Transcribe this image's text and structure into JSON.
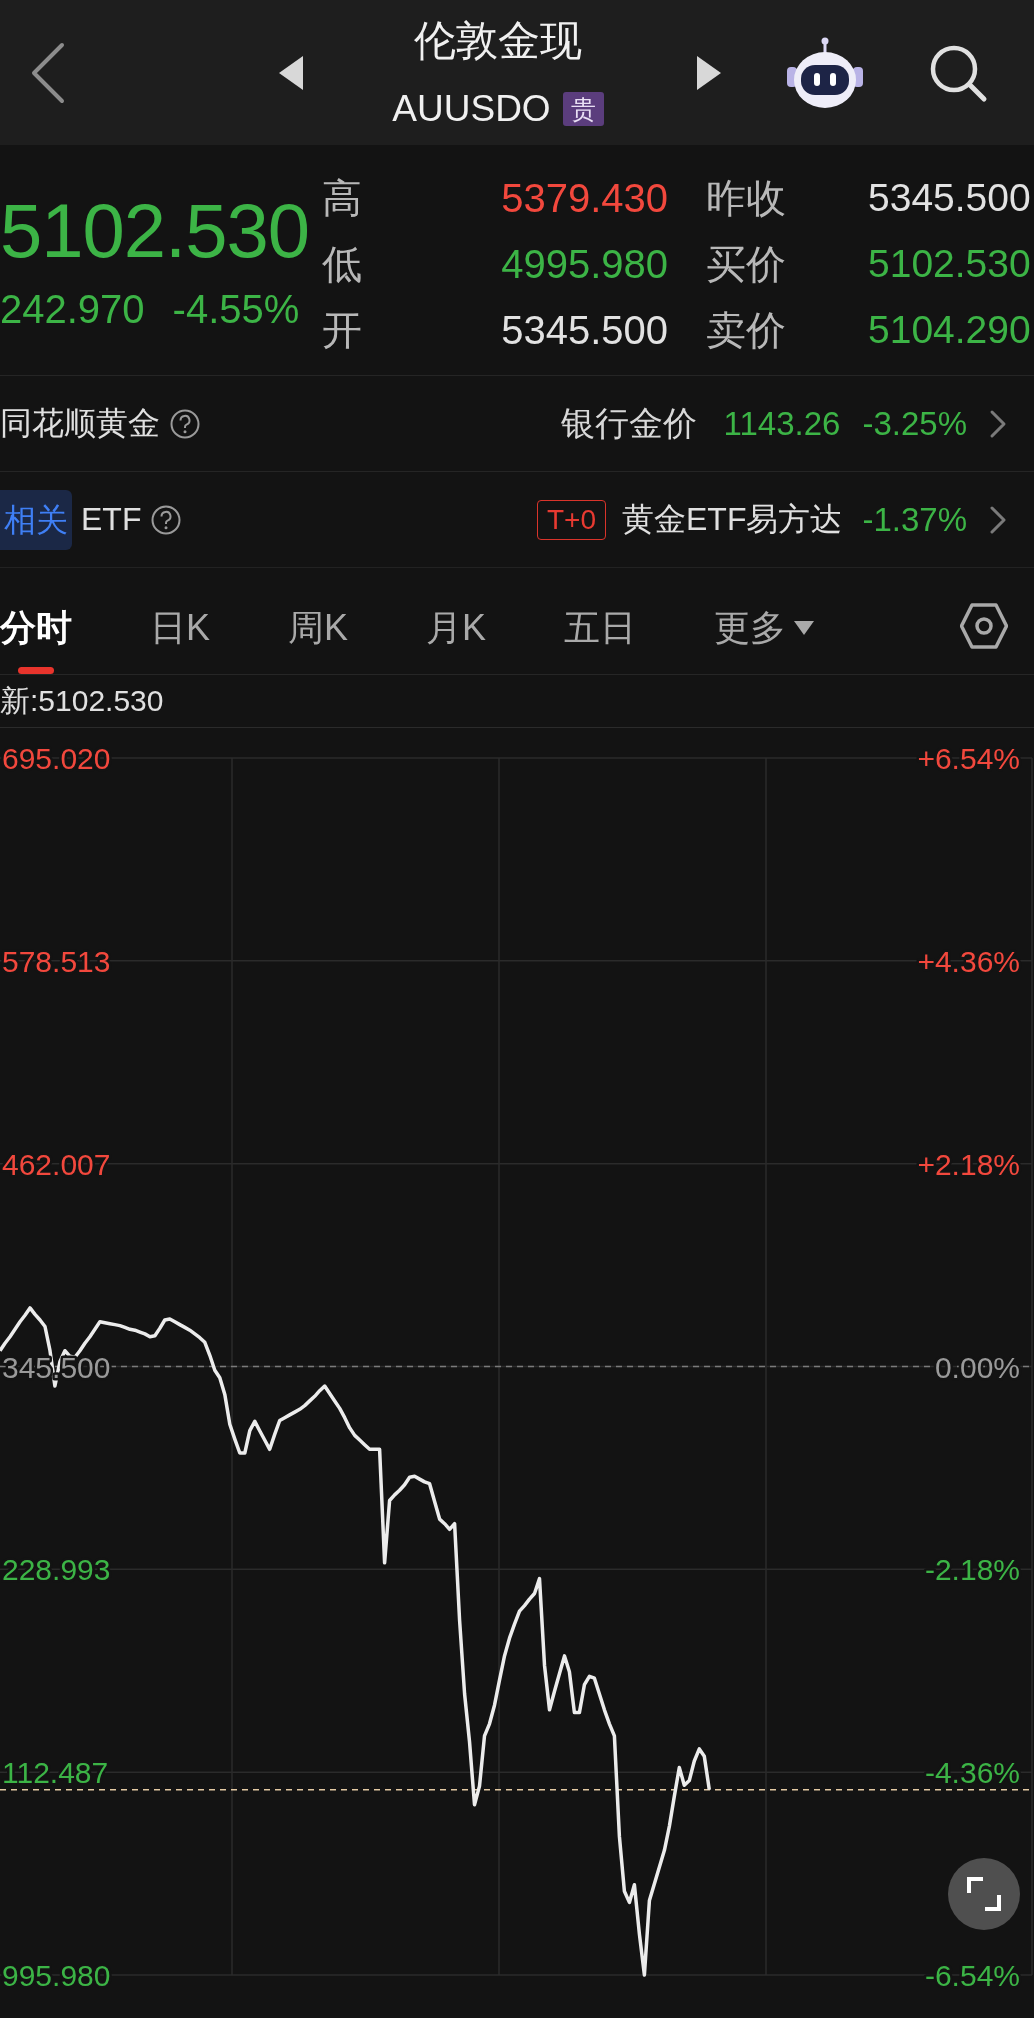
{
  "header": {
    "title": "伦敦金现",
    "code": "AUUSDO",
    "tag": "贵"
  },
  "quote": {
    "price": "5102.530",
    "change": "242.970",
    "change_percent": "-4.55%",
    "color": "#3cb446",
    "stat_rows": [
      [
        {
          "label": "高",
          "value": "5379.430",
          "color": "#f2483d"
        },
        {
          "label": "昨收",
          "value": "5345.500",
          "color": "#e2e2e2"
        }
      ],
      [
        {
          "label": "低",
          "value": "4995.980",
          "color": "#3cb446"
        },
        {
          "label": "买价",
          "value": "5102.530",
          "color": "#3cb446"
        }
      ],
      [
        {
          "label": "开",
          "value": "5345.500",
          "color": "#e2e2e2"
        },
        {
          "label": "卖价",
          "value": "5104.290",
          "color": "#3cb446"
        }
      ]
    ]
  },
  "gold_row": {
    "title": "同花顺黄金",
    "label": "银行金价",
    "value": "1143.26",
    "change": "-3.25%",
    "color": "#3cb446"
  },
  "etf_row": {
    "tag": "相关",
    "title": "ETF",
    "badge": "T+0",
    "name": "黄金ETF易方达",
    "change": "-1.37%",
    "color": "#3cb446"
  },
  "tabs": [
    {
      "label": "分时",
      "selected": true,
      "kind": "tab"
    },
    {
      "label": "日K",
      "selected": false,
      "kind": "tab"
    },
    {
      "label": "周K",
      "selected": false,
      "kind": "tab"
    },
    {
      "label": "月K",
      "selected": false,
      "kind": "tab"
    },
    {
      "label": "五日",
      "selected": false,
      "kind": "tab"
    },
    {
      "label": "更多",
      "selected": false,
      "kind": "menu"
    }
  ],
  "latest": "新:5102.530",
  "chart": {
    "left_labels": [
      "695.020",
      "578.513",
      "462.007",
      "345.500",
      "228.993",
      "112.487",
      "995.980"
    ],
    "chart_data": {
      "type": "line",
      "grid": true,
      "ylim": [
        -6.54,
        6.54
      ],
      "yticks": [
        {
          "value": 6.54,
          "label": "+6.54%"
        },
        {
          "value": 4.36,
          "label": "+4.36%"
        },
        {
          "value": 2.18,
          "label": "+2.18%"
        },
        {
          "value": 0,
          "label": "0.00%"
        },
        {
          "value": -2.18,
          "label": "-2.18%"
        },
        {
          "value": -4.36,
          "label": "-4.36%"
        },
        {
          "value": -6.54,
          "label": "-6.54%"
        }
      ],
      "ref_lines": [
        {
          "axis": "y",
          "value": 0,
          "color": "#7a7a7a"
        },
        {
          "axis": "y",
          "value": -4.55,
          "color": "#e3c9a3"
        }
      ],
      "values": [
        0.17,
        0.25,
        0.32,
        0.4,
        0.48,
        0.55,
        0.63,
        0.56,
        0.5,
        0.43,
        0.17,
        -0.21,
        0.05,
        0.17,
        0.11,
        0.1,
        0.17,
        0.25,
        0.32,
        0.4,
        0.48,
        0.47,
        0.46,
        0.45,
        0.44,
        0.42,
        0.4,
        0.39,
        0.37,
        0.35,
        0.32,
        0.33,
        0.41,
        0.5,
        0.51,
        0.48,
        0.45,
        0.42,
        0.39,
        0.35,
        0.31,
        0.26,
        0.12,
        -0.04,
        -0.12,
        -0.3,
        -0.62,
        -0.78,
        -0.93,
        -0.93,
        -0.69,
        -0.59,
        -0.69,
        -0.79,
        -0.89,
        -0.73,
        -0.58,
        -0.55,
        -0.52,
        -0.49,
        -0.46,
        -0.42,
        -0.37,
        -0.32,
        -0.26,
        -0.21,
        -0.29,
        -0.37,
        -0.45,
        -0.55,
        -0.66,
        -0.74,
        -0.79,
        -0.84,
        -0.89,
        -0.89,
        -0.89,
        -2.11,
        -1.44,
        -1.38,
        -1.33,
        -1.27,
        -1.19,
        -1.18,
        -1.21,
        -1.24,
        -1.26,
        -1.45,
        -1.64,
        -1.69,
        -1.75,
        -1.69,
        -2.73,
        -3.52,
        -4.03,
        -4.71,
        -4.51,
        -3.97,
        -3.84,
        -3.64,
        -3.37,
        -3.11,
        -2.92,
        -2.77,
        -2.63,
        -2.57,
        -2.5,
        -2.44,
        -2.28,
        -3.21,
        -3.69,
        -3.49,
        -3.3,
        -3.11,
        -3.28,
        -3.72,
        -3.72,
        -3.42,
        -3.33,
        -3.35,
        -3.52,
        -3.69,
        -3.84,
        -3.97,
        -5.05,
        -5.64,
        -5.76,
        -5.57,
        -6.1,
        -6.54,
        -5.74,
        -5.56,
        -5.38,
        -5.2,
        -4.94,
        -4.62,
        -4.31,
        -4.5,
        -4.45,
        -4.24,
        -4.11,
        -4.19,
        -4.55,
        null,
        null,
        null,
        null,
        null,
        null,
        null,
        null,
        null,
        null,
        null,
        null,
        null,
        null,
        null,
        null,
        null,
        null,
        null,
        null,
        null,
        null,
        null,
        null,
        null,
        null,
        null,
        null,
        null,
        null,
        null,
        null,
        null,
        null,
        null,
        null,
        null,
        null,
        null,
        null,
        null,
        null,
        null,
        null,
        null,
        null,
        null,
        null,
        null,
        null,
        null,
        null,
        null,
        null,
        null,
        null,
        null,
        null,
        null,
        null,
        null,
        null,
        null,
        null
      ]
    }
  }
}
